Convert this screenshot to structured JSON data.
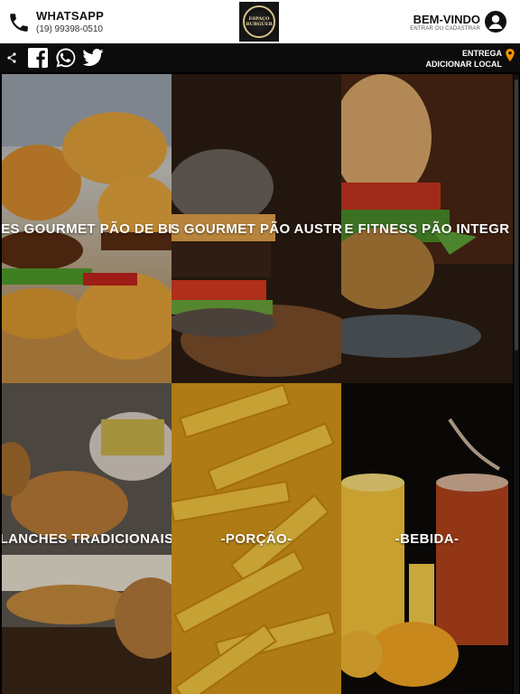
{
  "header": {
    "whatsapp_title": "WHATSAPP",
    "whatsapp_number": "(19) 99398-0510",
    "logo_text": "ESPAÇO\nBURGUER",
    "welcome_title": "BEM-VINDO",
    "welcome_subtitle": "ENTRAR OU CADASTRAR"
  },
  "social": {
    "icons": [
      "share-icon",
      "facebook-icon",
      "whatsapp-icon",
      "twitter-icon"
    ],
    "delivery_label": "Entrega",
    "delivery_action": "Adicionar Local"
  },
  "categories": [
    {
      "label": "ES GOURMET PÃO DE BI"
    },
    {
      "label": "S GOURMET PÃO AUSTR"
    },
    {
      "label": "E FITNESS PÃO INTEGR"
    },
    {
      "label": "LANCHES TRADICIONAIS"
    },
    {
      "label": "-PORÇÃO-"
    },
    {
      "label": "-BEBIDA-"
    }
  ],
  "colors": {
    "accent_orange": "#f39200",
    "social_bar_bg": "#0c0c0c",
    "header_bg": "#ffffff"
  }
}
